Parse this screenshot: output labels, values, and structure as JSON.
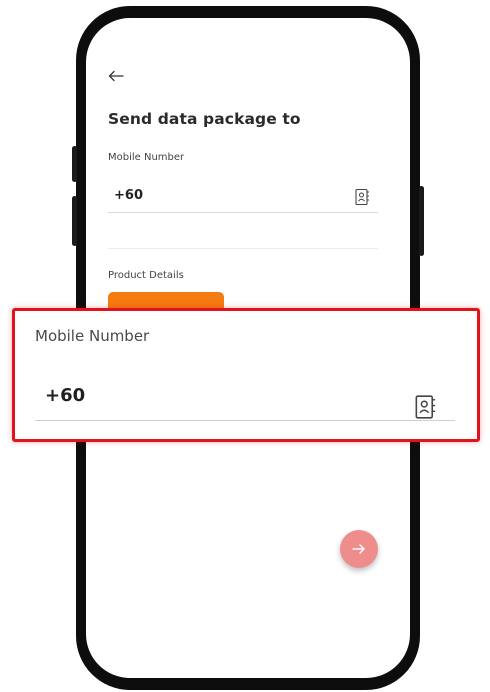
{
  "screen": {
    "title": "Send data package to",
    "mobile_label": "Mobile Number",
    "mobile_value": "+60",
    "product_label": "Product Details"
  },
  "zoom": {
    "mobile_label": "Mobile Number",
    "mobile_value": "+60"
  },
  "icons": {
    "back": "arrow-left-icon",
    "contact": "contact-book-icon",
    "next": "arrow-right-icon"
  },
  "colors": {
    "accent_orange": "#f47a12",
    "fab_color": "#ef8c8c",
    "highlight_red": "#e1141b"
  }
}
